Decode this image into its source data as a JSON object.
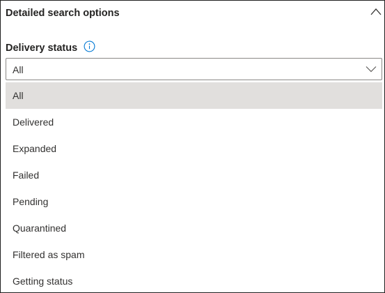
{
  "panel": {
    "title": "Detailed search options",
    "collapse_icon": "chevron-up-icon"
  },
  "delivery_status": {
    "label": "Delivery status",
    "info_icon": "info-icon",
    "selected_value": "All",
    "dropdown_icon": "chevron-down-icon",
    "options": [
      {
        "label": "All",
        "selected": true
      },
      {
        "label": "Delivered",
        "selected": false
      },
      {
        "label": "Expanded",
        "selected": false
      },
      {
        "label": "Failed",
        "selected": false
      },
      {
        "label": "Pending",
        "selected": false
      },
      {
        "label": "Quarantined",
        "selected": false
      },
      {
        "label": "Filtered as spam",
        "selected": false
      },
      {
        "label": "Getting status",
        "selected": false
      }
    ]
  },
  "colors": {
    "border": "#1f1f1f",
    "selected_option_bg": "#e1dfdd",
    "info_icon": "#0078d4",
    "text": "#323130"
  }
}
